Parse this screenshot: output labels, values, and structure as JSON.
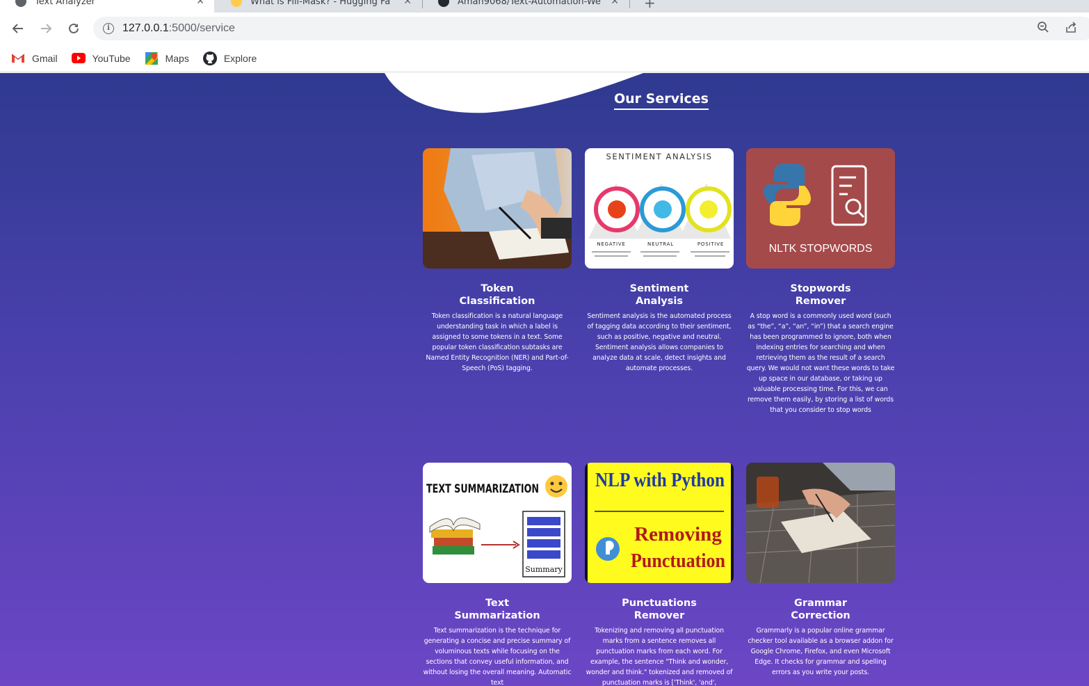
{
  "browser": {
    "tabs": [
      {
        "title": "Text Analyzer",
        "active": true
      },
      {
        "title": "What is Fill-Mask? - Hugging Fa",
        "active": false
      },
      {
        "title": "Aman9068/Text-Automation-We",
        "active": false
      }
    ],
    "url_host": "127.0.0.1",
    "url_rest": ":5000/service",
    "bookmarks": [
      {
        "label": "Gmail",
        "icon": "gmail-icon"
      },
      {
        "label": "YouTube",
        "icon": "youtube-icon"
      },
      {
        "label": "Maps",
        "icon": "maps-icon"
      },
      {
        "label": "Explore",
        "icon": "github-icon"
      }
    ]
  },
  "page": {
    "section_title": "Our Services",
    "colors": {
      "gradient_top": "#2f3a8f",
      "gradient_bottom": "#6c46c5",
      "text": "#ffffff"
    },
    "services": [
      {
        "title": "Token Classification",
        "description": "Token classification is a natural language understanding task in which a label is assigned to some tokens in a text. Some popular token classification subtasks are Named Entity Recognition (NER) and Part-of-Speech (PoS) tagging.",
        "image": "person-writing-photo"
      },
      {
        "title": "Sentiment Analysis",
        "description": "Sentiment analysis is the automated process of tagging data according to their sentiment, such as positive, negative and neutral. Sentiment analysis allows companies to analyze data at scale, detect insights and automate processes.",
        "image": "sentiment-analysis-graphic",
        "image_text": {
          "heading": "SENTIMENT ANALYSIS",
          "negative": "NEGATIVE",
          "neutral": "NEUTRAL",
          "positive": "POSITIVE"
        }
      },
      {
        "title": "Stopwords Remover",
        "description": "A stop word is a commonly used word (such as “the”, “a”, “an”, “in”) that a search engine has been programmed to ignore, both when indexing entries for searching and when retrieving them as the result of a search query. We would not want these words to take up space in our database, or taking up valuable processing time. For this, we can remove them easily, by storing a list of words that you consider to stop words",
        "image": "nltk-stopwords-graphic",
        "image_text": {
          "caption": "NLTK STOPWORDS"
        }
      },
      {
        "title": "Text Summarization",
        "description": "Text summarization is the technique for generating a concise and precise summary of voluminous texts while focusing on the sections that convey useful information, and without losing the overall meaning. Automatic text",
        "image": "text-summarization-graphic",
        "image_text": {
          "heading": "TEXT SUMMARIZATION",
          "label": "Summary"
        }
      },
      {
        "title": "Punctuations Remover",
        "description": "Tokenizing and removing all punctuation marks from a sentence removes all punctuation marks from each word. For example, the sentence \"Think and wonder, wonder and think.\" tokenized and removed of punctuation marks is ['Think', 'and',",
        "image": "nlp-python-graphic",
        "image_text": {
          "heading": "NLP with Python",
          "line1": "Removing",
          "line2": "Punctuation"
        }
      },
      {
        "title": "Grammar Correction",
        "description": "Grammarly is a popular online grammar checker tool available as a browser addon for Google Chrome, Firefox, and even Microsoft Edge. It checks for grammar and spelling errors as you write your posts.",
        "image": "desk-writing-photo"
      }
    ]
  }
}
